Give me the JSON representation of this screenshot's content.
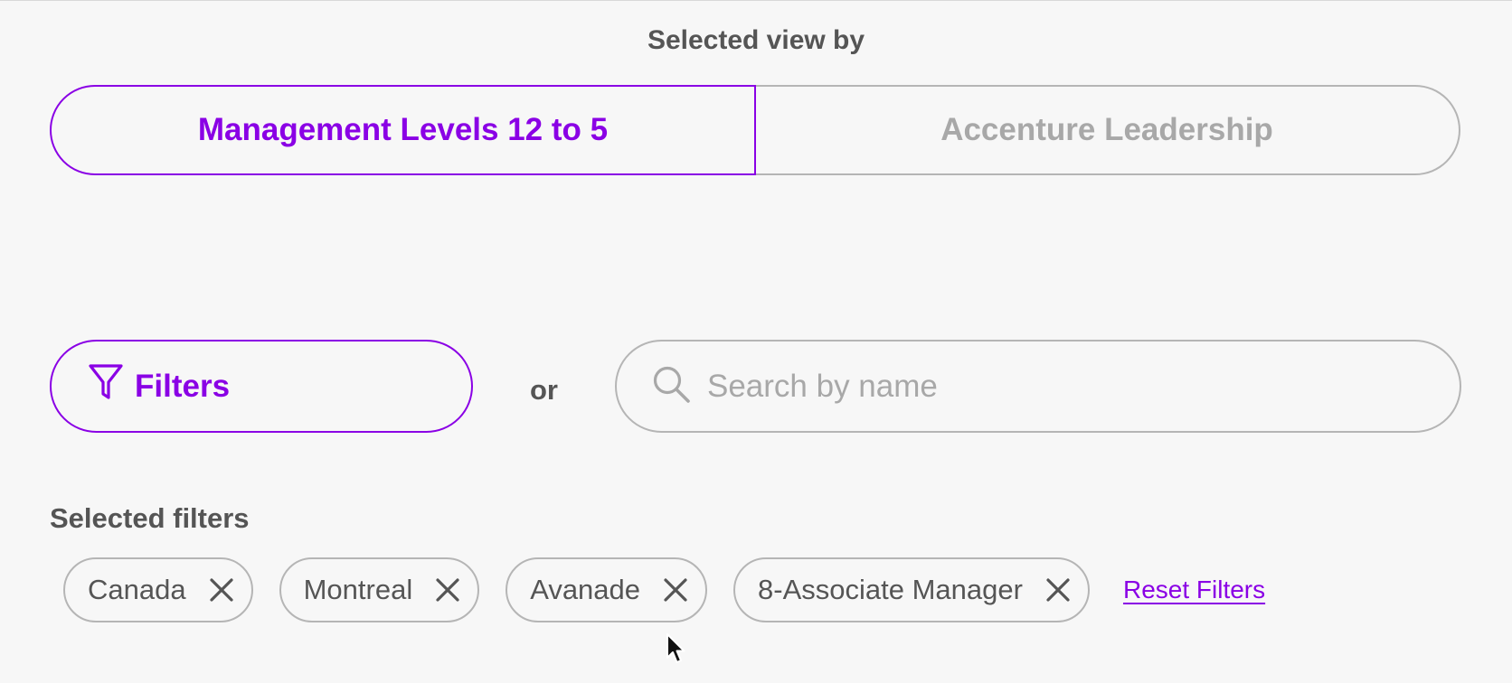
{
  "view_selector": {
    "heading": "Selected view by",
    "options": [
      {
        "label": "Management Levels 12 to 5",
        "selected": true
      },
      {
        "label": "Accenture Leadership",
        "selected": false
      }
    ]
  },
  "filters_button": {
    "label": "Filters",
    "icon": "filter-icon"
  },
  "separator": "or",
  "search": {
    "placeholder": "Search by name",
    "value": "",
    "icon": "search-icon"
  },
  "selected_filters": {
    "label": "Selected filters",
    "chips": [
      {
        "label": "Canada",
        "remove_icon": "close-icon"
      },
      {
        "label": "Montreal",
        "remove_icon": "close-icon"
      },
      {
        "label": "Avanade",
        "remove_icon": "close-icon"
      },
      {
        "label": "8-Associate Manager",
        "remove_icon": "close-icon"
      }
    ],
    "reset_label": "Reset Filters"
  },
  "colors": {
    "accent": "#8a00e5",
    "text": "#555555",
    "muted": "#a8a8a8",
    "border": "#b5b5b5",
    "background": "#f7f7f7"
  }
}
